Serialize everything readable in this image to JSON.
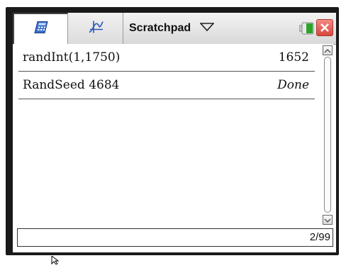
{
  "header": {
    "title": "Scratchpad"
  },
  "tabs": [
    {
      "name": "calculator",
      "icon": "calculator-icon"
    },
    {
      "name": "graphs",
      "icon": "graph-icon"
    }
  ],
  "history": [
    {
      "expression": "randInt(1,1750)",
      "result": "1652"
    },
    {
      "expression": "RandSeed 4684",
      "result": "Done"
    }
  ],
  "status": {
    "position": "2/99"
  },
  "colors": {
    "battery": "#2aa52a",
    "close": "#d8463c"
  }
}
